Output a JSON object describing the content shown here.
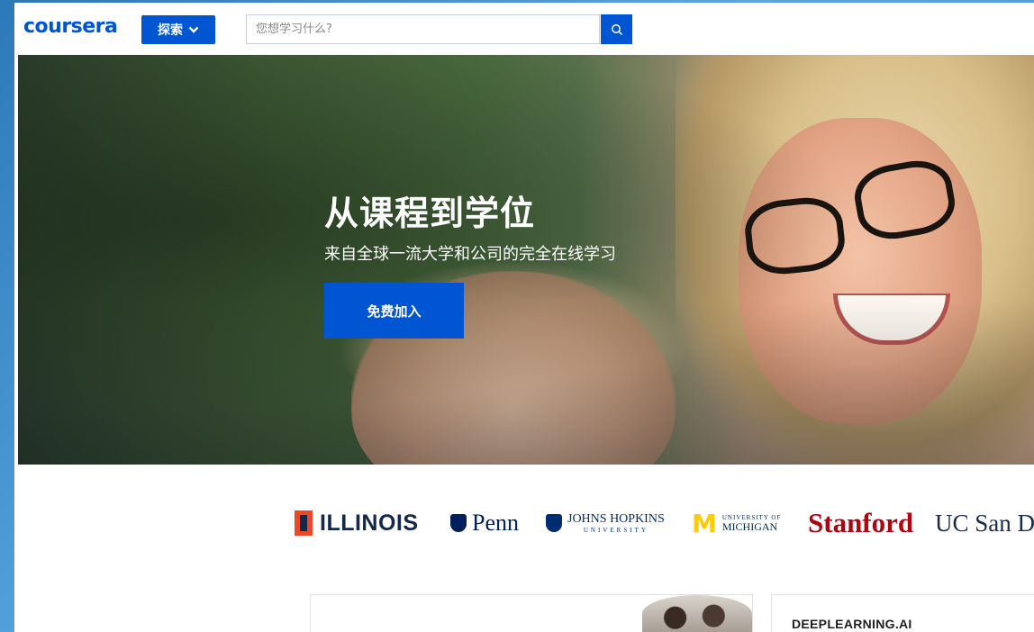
{
  "header": {
    "logo": "coursera",
    "explore_label": "探索",
    "search_placeholder": "您想学习什么?"
  },
  "hero": {
    "title": "从课程到学位",
    "subtitle": "来自全球一流大学和公司的完全在线学习",
    "join_label": "免费加入"
  },
  "partners": {
    "illinois": "ILLINOIS",
    "penn": "Penn",
    "jhu_main": "JOHNS HOPKINS",
    "jhu_sub": "UNIVERSITY",
    "michigan_small": "UNIVERSITY OF",
    "michigan_main": "MICHIGAN",
    "stanford": "Stanford",
    "ucsd": "UC San Di"
  },
  "cards": {
    "card2_label": "DEEPLEARNING.AI"
  },
  "colors": {
    "brand": "#0056d2",
    "illinois_orange": "#e84a27",
    "michigan_maize": "#ffcb05",
    "stanford_red": "#b1040e"
  }
}
